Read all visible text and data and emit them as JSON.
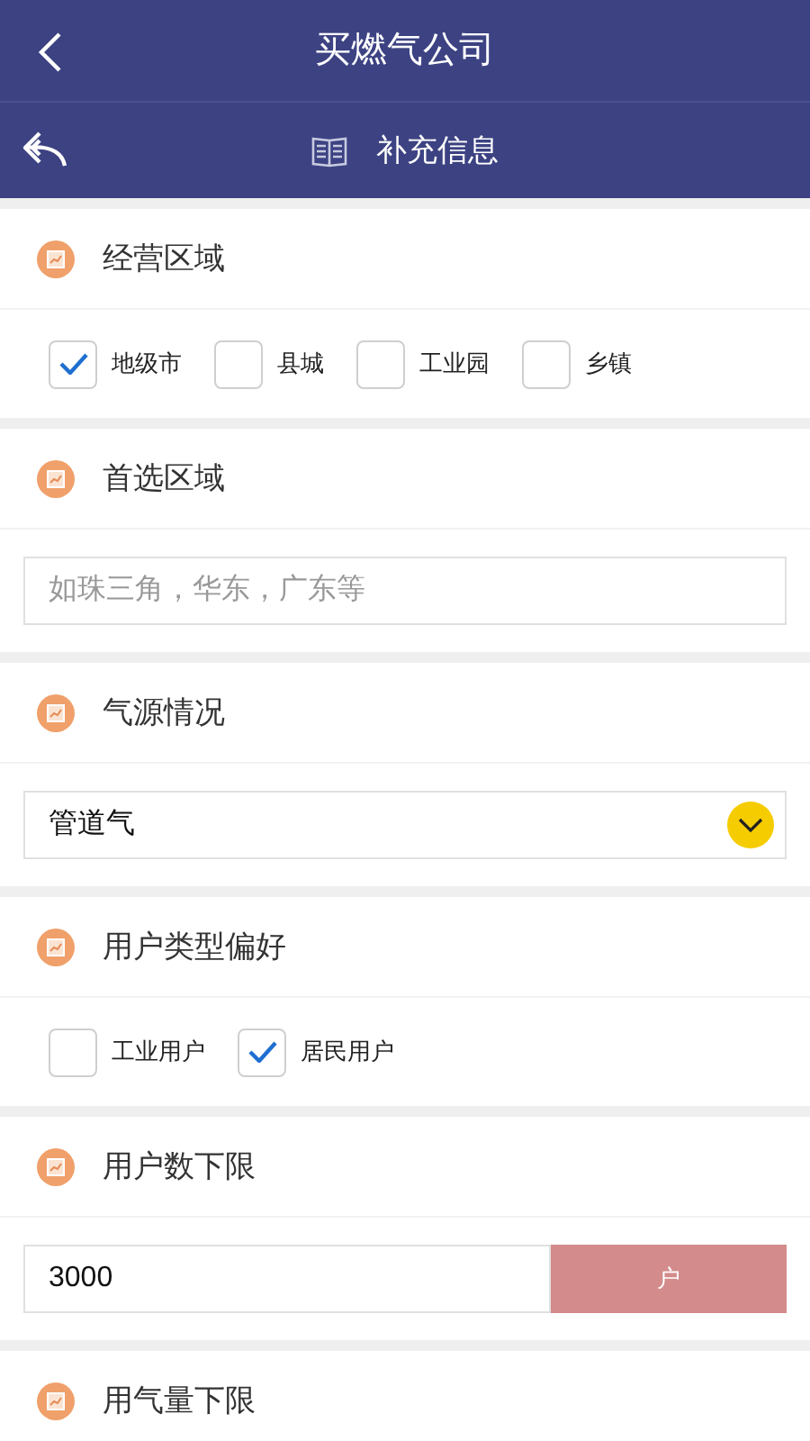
{
  "header": {
    "title": "买燃气公司"
  },
  "subheader": {
    "title": "补充信息"
  },
  "sections": [
    {
      "kind": "checkboxes",
      "label": "经营区域",
      "options": [
        {
          "label": "地级市",
          "checked": true
        },
        {
          "label": "县城",
          "checked": false
        },
        {
          "label": "工业园",
          "checked": false
        },
        {
          "label": "乡镇",
          "checked": false
        }
      ]
    },
    {
      "kind": "text",
      "label": "首选区域",
      "placeholder": "如珠三角，华东，广东等"
    },
    {
      "kind": "select",
      "label": "气源情况",
      "value": "管道气"
    },
    {
      "kind": "checkboxes",
      "label": "用户类型偏好",
      "options": [
        {
          "label": "工业用户",
          "checked": false
        },
        {
          "label": "居民用户",
          "checked": true
        }
      ]
    },
    {
      "kind": "number_unit",
      "label": "用户数下限",
      "value": "3000",
      "unit": "户"
    },
    {
      "kind": "header_only",
      "label": "用气量下限"
    }
  ]
}
